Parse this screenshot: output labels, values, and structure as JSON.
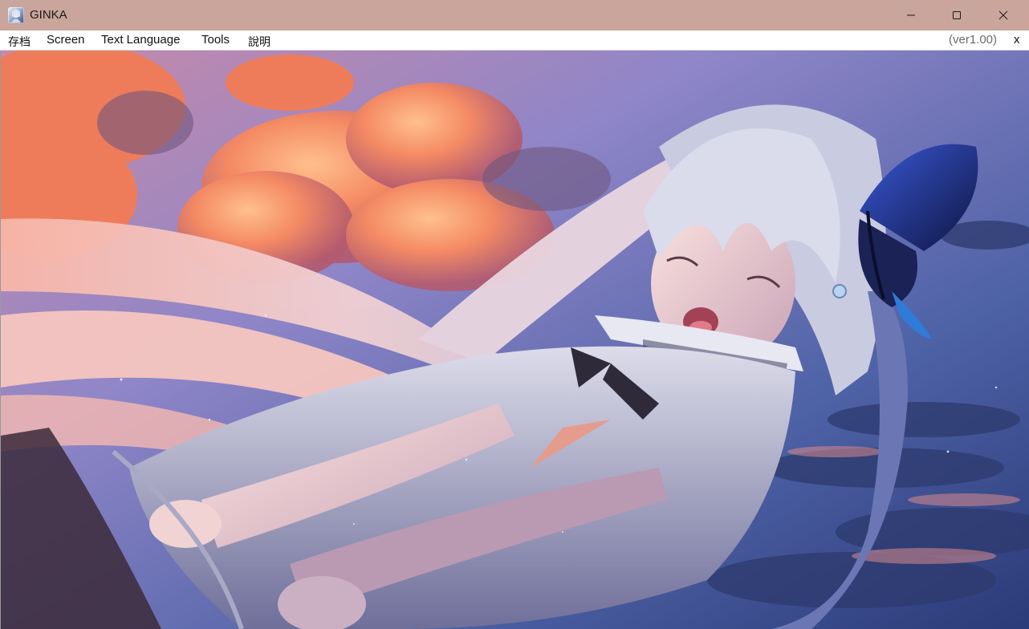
{
  "window": {
    "title": "GINKA",
    "controls": {
      "minimize": "minimize",
      "maximize": "maximize",
      "close": "close"
    }
  },
  "menubar": {
    "items": [
      {
        "label": "存档"
      },
      {
        "label": "Screen"
      },
      {
        "label": "Text Language"
      },
      {
        "label": "Tools"
      },
      {
        "label": "說明"
      }
    ],
    "version": "(ver1.00)",
    "close_label": "x"
  },
  "game_screen": {
    "scene": "anime-illustration",
    "palette": {
      "sky_top": "#8e86c9",
      "sky_right": "#3f5aa0",
      "cloud_orange": "#f0875f",
      "hair": "#e8c9d0",
      "dress": "#c8c9de",
      "butterfly": "#1f2e7a"
    }
  }
}
